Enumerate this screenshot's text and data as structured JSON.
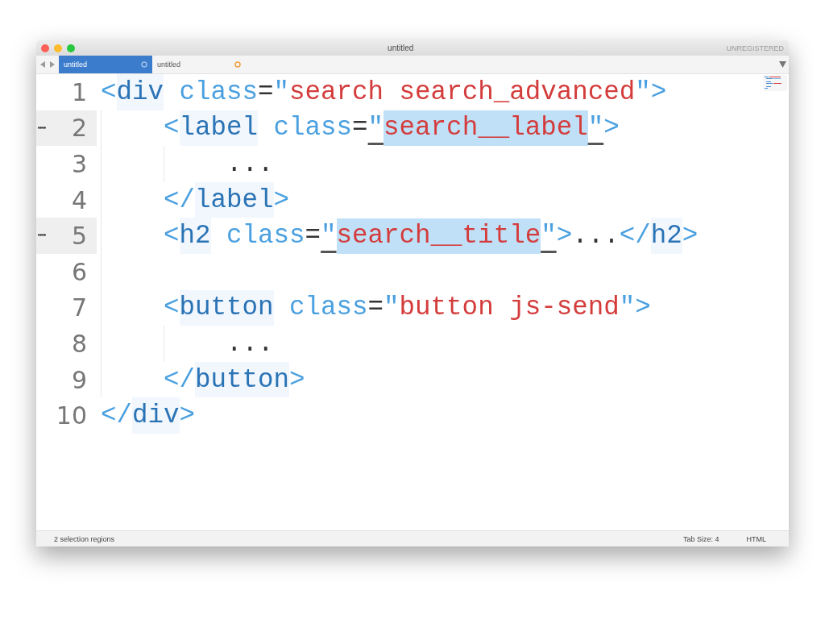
{
  "window": {
    "title": "untitled",
    "badge": "UNREGISTERED"
  },
  "tabs": [
    {
      "label": "untitled",
      "selected": true,
      "modified": false
    },
    {
      "label": "untitled",
      "selected": false,
      "modified": true
    }
  ],
  "editor": {
    "lines": [
      {
        "number": "1",
        "current": false,
        "tokens": [
          {
            "kind": "punct",
            "text": "<"
          },
          {
            "kind": "tag",
            "text": "div"
          },
          {
            "kind": "attr",
            "text": "class"
          },
          {
            "kind": "op",
            "text": "="
          },
          {
            "kind": "punct",
            "text": "\""
          },
          {
            "kind": "str",
            "text": "search search_advanced"
          },
          {
            "kind": "punct",
            "text": "\""
          },
          {
            "kind": "punct",
            "text": ">"
          }
        ],
        "children": [
          {
            "number": "2",
            "current": true,
            "tokens": [
              {
                "kind": "punct",
                "text": "<"
              },
              {
                "kind": "tag",
                "text": "label"
              },
              {
                "kind": "attr",
                "text": "class"
              },
              {
                "kind": "op",
                "text": "="
              },
              {
                "kind": "match",
                "text": "\""
              },
              {
                "kind": "selection",
                "text": "search__label"
              },
              {
                "kind": "match",
                "text": "\""
              },
              {
                "kind": "punct",
                "text": ">"
              }
            ],
            "children": [
              {
                "number": "3",
                "current": false,
                "tokens": [
                  {
                    "kind": "op",
                    "text": "..."
                  }
                ]
              }
            ]
          },
          {
            "number": "4",
            "current": false,
            "tokens": [
              {
                "kind": "punct",
                "text": "</"
              },
              {
                "kind": "tag",
                "text": "label"
              },
              {
                "kind": "punct",
                "text": ">"
              }
            ]
          },
          {
            "number": "5",
            "current": true,
            "tokens": [
              {
                "kind": "punct",
                "text": "<"
              },
              {
                "kind": "tag",
                "text": "h2"
              },
              {
                "kind": "attr",
                "text": "class"
              },
              {
                "kind": "op",
                "text": "="
              },
              {
                "kind": "match",
                "text": "\""
              },
              {
                "kind": "selection",
                "text": "search__title"
              },
              {
                "kind": "match",
                "text": "\""
              },
              {
                "kind": "punct",
                "text": ">"
              },
              {
                "kind": "op",
                "text": "..."
              },
              {
                "kind": "punct",
                "text": "</"
              },
              {
                "kind": "tag",
                "text": "h2"
              },
              {
                "kind": "punct",
                "text": ">"
              }
            ]
          },
          {
            "number": "6",
            "current": false
          },
          {
            "number": "7",
            "current": false,
            "tokens": [
              {
                "kind": "punct",
                "text": "<"
              },
              {
                "kind": "tag",
                "text": "button"
              },
              {
                "kind": "attr",
                "text": "class"
              },
              {
                "kind": "op",
                "text": "="
              },
              {
                "kind": "punct",
                "text": "\""
              },
              {
                "kind": "str",
                "text": "button js-send"
              },
              {
                "kind": "punct",
                "text": "\""
              },
              {
                "kind": "punct",
                "text": ">"
              }
            ],
            "children": [
              {
                "number": "8",
                "current": false,
                "tokens": [
                  {
                    "kind": "op",
                    "text": "..."
                  }
                ]
              }
            ]
          },
          {
            "number": "9",
            "current": false,
            "tokens": [
              {
                "kind": "punct",
                "text": "</"
              },
              {
                "kind": "tag",
                "text": "button"
              },
              {
                "kind": "punct",
                "text": ">"
              }
            ]
          }
        ]
      },
      {
        "number": "10",
        "current": false,
        "tokens": [
          {
            "kind": "punct",
            "text": "</"
          },
          {
            "kind": "tag",
            "text": "div"
          },
          {
            "kind": "punct",
            "text": ">"
          }
        ]
      }
    ]
  },
  "status_bar": {
    "left": "2 selection regions",
    "tab_size": "Tab Size: 4",
    "syntax": "HTML"
  }
}
